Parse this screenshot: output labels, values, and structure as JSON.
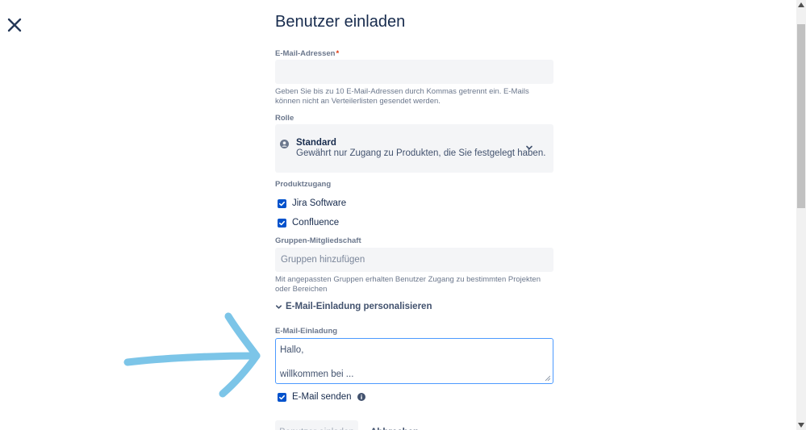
{
  "title": "Benutzer einladen",
  "close_icon": "close-icon",
  "email": {
    "label": "E-Mail-Adressen",
    "required_mark": "*",
    "value": "",
    "helper": "Geben Sie bis zu 10 E-Mail-Adressen durch Kommas getrennt ein. E-Mails können nicht an Verteilerlisten gesendet werden."
  },
  "role": {
    "label": "Rolle",
    "selected_name": "Standard",
    "selected_description": "Gewährt nur Zugang zu Produkten, die Sie festgelegt haben.",
    "icon": "user-icon"
  },
  "product_access": {
    "label": "Produktzugang",
    "items": [
      {
        "label": "Jira Software",
        "checked": true
      },
      {
        "label": "Confluence",
        "checked": true
      }
    ]
  },
  "groups": {
    "label": "Gruppen-Mitgliedschaft",
    "placeholder": "Gruppen hinzufügen",
    "helper": "Mit angepassten Gruppen erhalten Benutzer Zugang zu bestimmten Projekten oder Bereichen"
  },
  "personalize": {
    "label": "E-Mail-Einladung personalisieren",
    "expanded": true
  },
  "invite_message": {
    "label": "E-Mail-Einladung",
    "value": "Hallo,\n\nwillkommen bei ..."
  },
  "send_email": {
    "label": "E-Mail senden",
    "checked": true,
    "icon": "info-icon"
  },
  "actions": {
    "submit_label": "Benutzer einladen",
    "cancel_label": "Abbrechen"
  },
  "colors": {
    "primary": "#0052cc",
    "focus_border": "#4c9aff",
    "field_background": "#f4f5f7",
    "annotation": "#7cc5e8"
  }
}
